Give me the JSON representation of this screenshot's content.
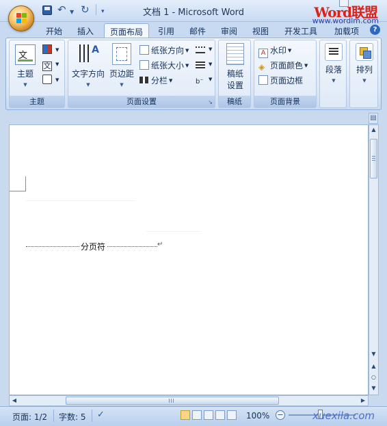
{
  "window": {
    "title": "文档 1 - Microsoft Word",
    "watermark_brand": "Word联盟",
    "watermark_url": "www.wordlm.com",
    "status_watermark": "xuexila.com"
  },
  "quick_access": {
    "save_icon": "save-icon",
    "undo_icon": "undo-icon",
    "redo_icon": "redo-icon"
  },
  "tabs": [
    {
      "label": "开始"
    },
    {
      "label": "插入"
    },
    {
      "label": "页面布局",
      "active": true
    },
    {
      "label": "引用"
    },
    {
      "label": "邮件"
    },
    {
      "label": "审阅"
    },
    {
      "label": "视图"
    },
    {
      "label": "开发工具"
    },
    {
      "label": "加载项"
    }
  ],
  "ribbon": {
    "groups": {
      "theme": {
        "label": "主题",
        "theme_button": "主题"
      },
      "page_setup": {
        "label": "页面设置",
        "text_direction": "文字方向",
        "margins": "页边距",
        "orientation": "纸张方向",
        "size": "纸张大小",
        "columns": "分栏"
      },
      "draft": {
        "label": "稿纸",
        "draft_setup_line1": "稿纸",
        "draft_setup_line2": "设置"
      },
      "page_background": {
        "label": "页面背景",
        "watermark": "水印",
        "page_color": "页面颜色",
        "page_borders": "页面边框"
      },
      "paragraph": {
        "label": "段落"
      },
      "arrange": {
        "label": "排列"
      }
    }
  },
  "document": {
    "page_break_label": "分页符",
    "paragraph_mark": "↵"
  },
  "statusbar": {
    "page": "页面: 1/2",
    "words": "字数: 5",
    "zoom": "100%"
  },
  "colors": {
    "accent_blue": "#2e69c2",
    "ribbon_bg": "#dce8f7",
    "active_view": "#f7d783",
    "watermark_red": "#d9241c"
  }
}
